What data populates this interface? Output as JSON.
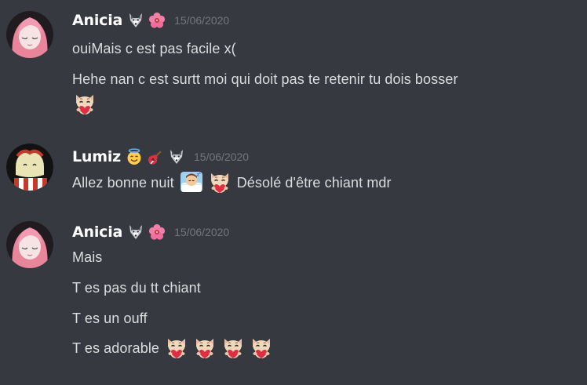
{
  "messages": [
    {
      "author": "Anicia",
      "badges": [
        "wolf-badge-icon",
        "hibiscus-badge-icon"
      ],
      "timestamp": "15/06/2020",
      "lines": [
        "ouiMais c est pas facile x(",
        "Hehe nan c est surtt moi qui doit pas te retenir tu dois bosser"
      ]
    },
    {
      "author": "Lumiz",
      "badges": [
        "halo-smile-badge-icon",
        "guitar-badge-icon",
        "wolf-badge-icon"
      ],
      "timestamp": "15/06/2020",
      "lines": [
        "Allez bonne nuit",
        "Désolé d'être chiant mdr"
      ]
    },
    {
      "author": "Anicia",
      "badges": [
        "wolf-badge-icon",
        "hibiscus-badge-icon"
      ],
      "timestamp": "15/06/2020",
      "lines": [
        "Mais",
        "T es pas du tt chiant",
        "T es un ouff",
        "T es adorable"
      ]
    }
  ],
  "colors": {
    "background": "#36393f",
    "username": "#ffffff",
    "text": "#dcddde",
    "timestamp": "#72767d",
    "avatar_pink": "#e8859a"
  }
}
